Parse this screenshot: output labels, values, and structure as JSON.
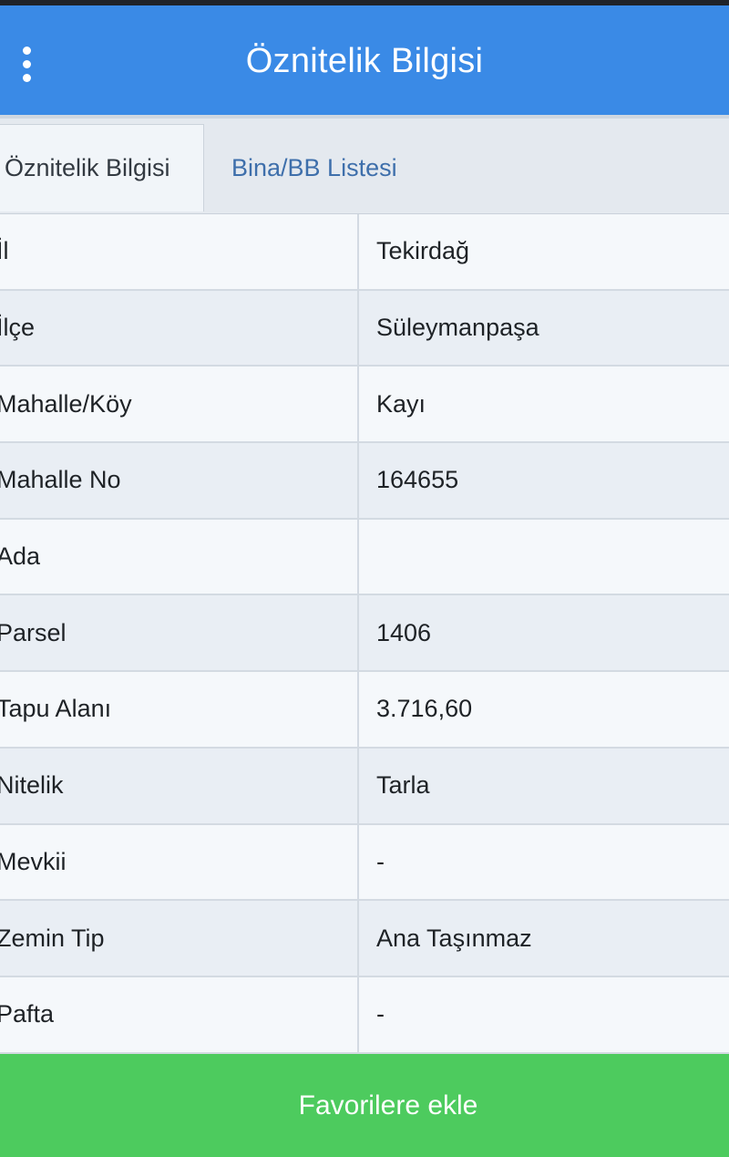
{
  "header": {
    "title": "Öznitelik Bilgisi"
  },
  "tabs": [
    {
      "label": "Öznitelik Bilgisi",
      "active": true
    },
    {
      "label": "Bina/BB Listesi",
      "active": false
    }
  ],
  "rows": [
    {
      "label": "İl",
      "value": "Tekirdağ"
    },
    {
      "label": "İlçe",
      "value": "Süleymanpaşa"
    },
    {
      "label": "Mahalle/Köy",
      "value": "Kayı"
    },
    {
      "label": "Mahalle No",
      "value": "164655"
    },
    {
      "label": "Ada",
      "value": ""
    },
    {
      "label": "Parsel",
      "value": "1406"
    },
    {
      "label": "Tapu Alanı",
      "value": "3.716,60"
    },
    {
      "label": "Nitelik",
      "value": "Tarla"
    },
    {
      "label": "Mevkii",
      "value": "-"
    },
    {
      "label": "Zemin Tip",
      "value": "Ana Taşınmaz"
    },
    {
      "label": "Pafta",
      "value": "-"
    }
  ],
  "footer": {
    "button_label": "Favorilere ekle"
  },
  "colors": {
    "header_bg": "#3a8ae6",
    "button_bg": "#4dcb5e",
    "tab_link": "#3e6fab"
  },
  "icons": {
    "menu": "vertical-ellipsis-icon"
  }
}
